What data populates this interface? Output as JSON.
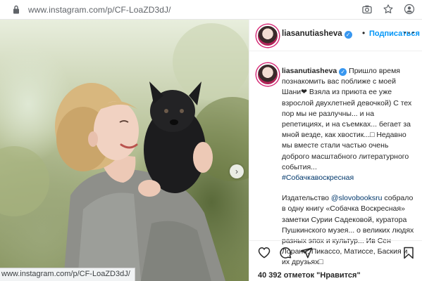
{
  "browser": {
    "url_host": "www.instagram.com",
    "url_path": "/p/CF-LoaZD3dJ/",
    "status_url": "www.instagram.com/p/CF-LoaZD3dJ/"
  },
  "post": {
    "username": "liasanutiasheva",
    "follow_label": "Подписаться",
    "more_label": "···",
    "caption_para1": "Пришло время познакомить вас поближе с моей Шани❤ Взяла из приюта ее уже взрослой двухлетней девочкой) С тех пор мы не разлучны... и на репетициях, и на съемках... бегает за мной везде, как хвостик...□ Недавно мы вместе стали частью очень доброго масштабного литературного события...",
    "hashtag": "#Собачкавоскресная",
    "caption_para2_prefix": "Издательство ",
    "mention": "@slovobooksru",
    "caption_para2_rest": " собрало в одну книгу «Собачка Воскресная» заметки Сурии Садековой, куратора Пушкинского музея... о великих людях разных эпох и культур... Ив Сен Лоране, Пикассо, Матиссе, Баския и их друзьях□",
    "likes_text": "40 392 отметок \"Нравится\""
  },
  "icons": {
    "lock": "lock-icon",
    "camera": "camera-icon",
    "star": "star-icon",
    "profile": "profile-icon",
    "next": "chevron-right-icon",
    "like": "heart-icon",
    "comment": "comment-icon",
    "share": "paper-plane-icon",
    "save": "bookmark-icon"
  },
  "colors": {
    "accent_blue": "#0095f6",
    "verified_blue": "#3897f0",
    "link_blue": "#00376b"
  }
}
